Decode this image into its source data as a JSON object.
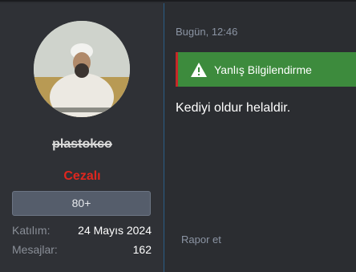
{
  "user": {
    "username": "plastokco",
    "role": "Cezalı",
    "score_label": "80+",
    "joined_label": "Katılım:",
    "joined_value": "24 Mayıs 2024",
    "messages_label": "Mesajlar:",
    "messages_value": "162",
    "avatar_icon": "profile-photo"
  },
  "post": {
    "date": "Bugün, 12:46",
    "flag_label": "Yanlış Bilgilendirme",
    "flag_icon": "warning-triangle-icon",
    "body": "Kediyi oldur helaldir.",
    "report_label": "Rapor et"
  },
  "colors": {
    "background": "#2b2d31",
    "role_color": "#e0261e",
    "flag_bg": "#3d8b3d",
    "flag_border": "#c62828",
    "divider": "#2a5d86"
  }
}
